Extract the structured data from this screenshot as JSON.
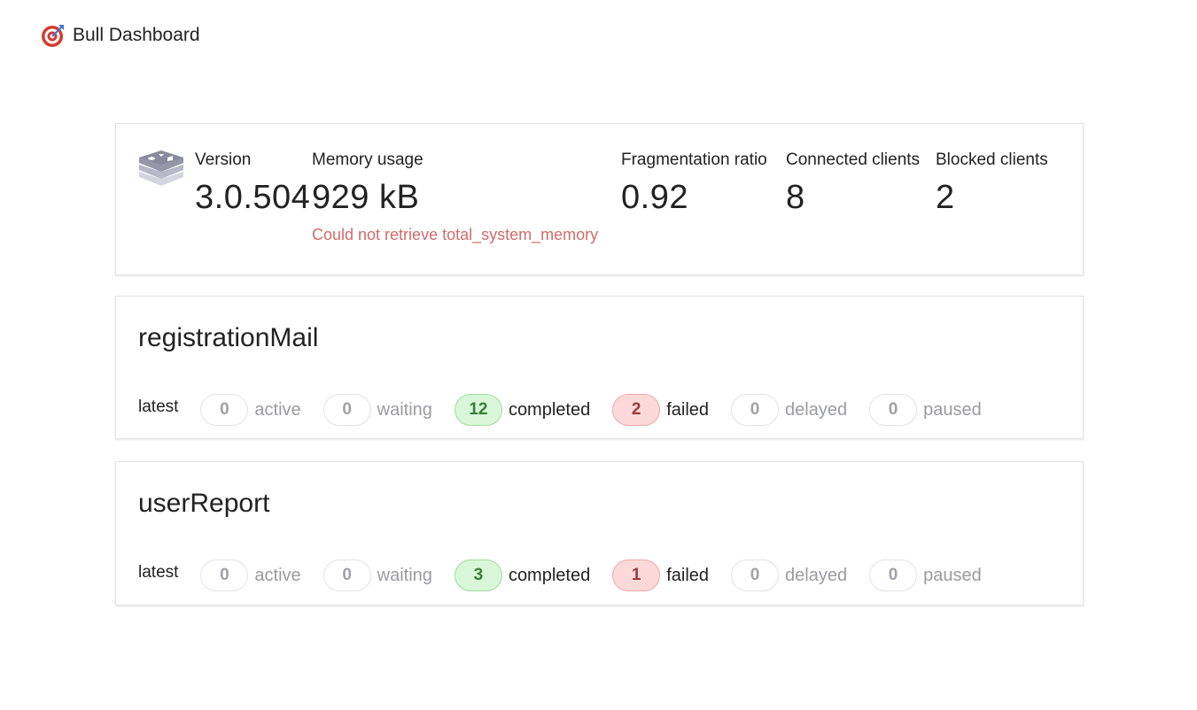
{
  "header": {
    "title": "Bull Dashboard",
    "logo_icon": "target-logo-icon"
  },
  "redis": {
    "icon": "redis-stack-icon",
    "version": {
      "label": "Version",
      "value": "3.0.504"
    },
    "memory": {
      "label": "Memory usage",
      "value": "929 kB",
      "error": "Could not retrieve total_system_memory"
    },
    "fragmentation": {
      "label": "Fragmentation ratio",
      "value": "0.92"
    },
    "connected": {
      "label": "Connected clients",
      "value": "8"
    },
    "blocked": {
      "label": "Blocked clients",
      "value": "2"
    }
  },
  "queues": [
    {
      "name": "registrationMail",
      "latest_label": "latest",
      "statuses": {
        "active": {
          "count": "0",
          "label": "active"
        },
        "waiting": {
          "count": "0",
          "label": "waiting"
        },
        "completed": {
          "count": "12",
          "label": "completed"
        },
        "failed": {
          "count": "2",
          "label": "failed"
        },
        "delayed": {
          "count": "0",
          "label": "delayed"
        },
        "paused": {
          "count": "0",
          "label": "paused"
        }
      }
    },
    {
      "name": "userReport",
      "latest_label": "latest",
      "statuses": {
        "active": {
          "count": "0",
          "label": "active"
        },
        "waiting": {
          "count": "0",
          "label": "waiting"
        },
        "completed": {
          "count": "3",
          "label": "completed"
        },
        "failed": {
          "count": "1",
          "label": "failed"
        },
        "delayed": {
          "count": "0",
          "label": "delayed"
        },
        "paused": {
          "count": "0",
          "label": "paused"
        }
      }
    }
  ],
  "colors": {
    "completed_bg": "#d8f7d8",
    "failed_bg": "#fcd9d9",
    "error_text": "#d26a6a"
  }
}
